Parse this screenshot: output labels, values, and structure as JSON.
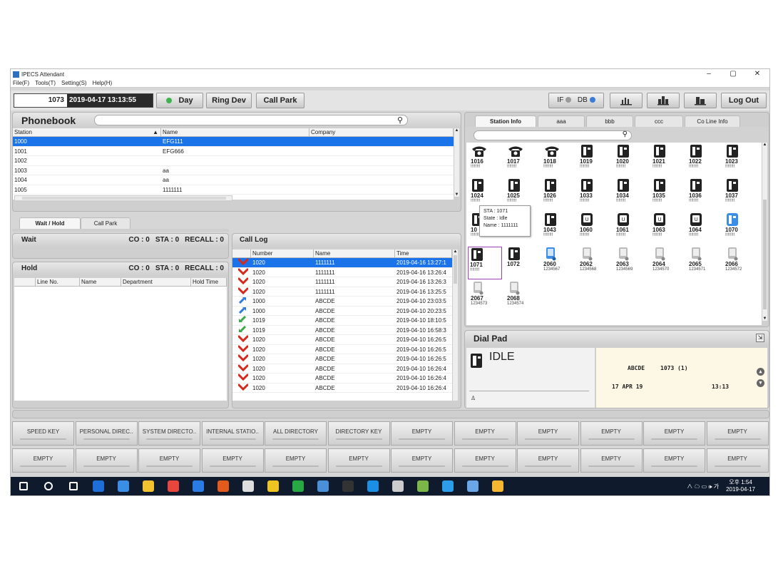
{
  "window": {
    "title": "IPECS Attendant",
    "menu": [
      "File(F)",
      "Tools(T)",
      "Setting(S)",
      "Help(H)"
    ],
    "controls": {
      "minimize": "–",
      "maximize": "▢",
      "close": "✕"
    }
  },
  "toolbar": {
    "extension": "1073",
    "datetime": "2019-04-17 13:13:55",
    "day_label": "Day",
    "ring_dev_label": "Ring Dev",
    "call_park_label": "Call Park",
    "if_label": "IF",
    "db_label": "DB",
    "logout_label": "Log Out",
    "colors": {
      "day_led": "#3cb44b",
      "if_led": "#9a9a9a",
      "db_led": "#3a7bd5"
    }
  },
  "phonebook": {
    "title": "Phonebook",
    "columns": [
      "Station",
      "Name",
      "Company"
    ],
    "rows": [
      {
        "station": "1000",
        "name": "EFG111",
        "company": "",
        "selected": true
      },
      {
        "station": "1001",
        "name": "EFG666",
        "company": ""
      },
      {
        "station": "1002",
        "name": "",
        "company": ""
      },
      {
        "station": "1003",
        "name": "aa",
        "company": ""
      },
      {
        "station": "1004",
        "name": "aa",
        "company": ""
      },
      {
        "station": "1005",
        "name": "1111111",
        "company": ""
      }
    ]
  },
  "wait_hold": {
    "tabs": [
      "Wait / Hold",
      "Call Park"
    ],
    "wait": {
      "title": "Wait",
      "co": "CO : 0",
      "sta": "STA : 0",
      "recall": "RECALL : 0"
    },
    "hold": {
      "title": "Hold",
      "co": "CO : 0",
      "sta": "STA : 0",
      "recall": "RECALL : 0",
      "columns": [
        "Line No.",
        "Name",
        "Department",
        "Hold Time"
      ]
    }
  },
  "call_log": {
    "title": "Call Log",
    "columns": [
      "Number",
      "Name",
      "Time"
    ],
    "rows": [
      {
        "type": "missed",
        "number": "1020",
        "name": "1111111",
        "time": "2019-04-16 13:27:1",
        "selected": true
      },
      {
        "type": "missed",
        "number": "1020",
        "name": "1111111",
        "time": "2019-04-16 13:26:4"
      },
      {
        "type": "missed",
        "number": "1020",
        "name": "1111111",
        "time": "2019-04-16 13:26:3"
      },
      {
        "type": "missed",
        "number": "1020",
        "name": "1111111",
        "time": "2019-04-16 13:25:5"
      },
      {
        "type": "outgoing",
        "number": "1000",
        "name": "ABCDE",
        "time": "2019-04-10 23:03:5"
      },
      {
        "type": "outgoing",
        "number": "1000",
        "name": "ABCDE",
        "time": "2019-04-10 20:23:5"
      },
      {
        "type": "incoming",
        "number": "1019",
        "name": "ABCDE",
        "time": "2019-04-10 18:10:5"
      },
      {
        "type": "incoming",
        "number": "1019",
        "name": "ABCDE",
        "time": "2019-04-10 16:58:3"
      },
      {
        "type": "missed",
        "number": "1020",
        "name": "ABCDE",
        "time": "2019-04-10 16:26:5"
      },
      {
        "type": "missed",
        "number": "1020",
        "name": "ABCDE",
        "time": "2019-04-10 16:26:5"
      },
      {
        "type": "missed",
        "number": "1020",
        "name": "ABCDE",
        "time": "2019-04-10 16:26:5"
      },
      {
        "type": "missed",
        "number": "1020",
        "name": "ABCDE",
        "time": "2019-04-10 16:26:4"
      },
      {
        "type": "missed",
        "number": "1020",
        "name": "ABCDE",
        "time": "2019-04-10 16:26:4"
      },
      {
        "type": "missed",
        "number": "1020",
        "name": "ABCDE",
        "time": "2019-04-10 16:26:4"
      }
    ]
  },
  "station_info": {
    "tabs": [
      "Station Info",
      "aaa",
      "bbb",
      "ccc",
      "Co Line Info"
    ],
    "stations": [
      {
        "num": "1016",
        "sub": "!!!!!!!!",
        "kind": "analog"
      },
      {
        "num": "1017",
        "sub": "!!!!!!!!",
        "kind": "analog"
      },
      {
        "num": "1018",
        "sub": "!!!!!!!!",
        "kind": "analog"
      },
      {
        "num": "1019",
        "sub": "!!!!!!!!",
        "kind": "digital"
      },
      {
        "num": "1020",
        "sub": "!!!!!!!!",
        "kind": "digital"
      },
      {
        "num": "1021",
        "sub": "!!!!!!!!",
        "kind": "digital"
      },
      {
        "num": "1022",
        "sub": "!!!!!!!!",
        "kind": "digital"
      },
      {
        "num": "1023",
        "sub": "!!!!!!!!",
        "kind": "digital"
      },
      {
        "num": "1024",
        "sub": "!!!!!!!!",
        "kind": "digital"
      },
      {
        "num": "1025",
        "sub": "!!!!!!!!",
        "kind": "digital"
      },
      {
        "num": "1026",
        "sub": "!!!!!!!!",
        "kind": "digital"
      },
      {
        "num": "1033",
        "sub": "!!!!!!!!",
        "kind": "digital"
      },
      {
        "num": "1034",
        "sub": "!!!!!!!!",
        "kind": "digital"
      },
      {
        "num": "1035",
        "sub": "!!!!!!!!",
        "kind": "digital"
      },
      {
        "num": "1036",
        "sub": "!!!!!!!!",
        "kind": "digital"
      },
      {
        "num": "1037",
        "sub": "!!!!!!!!",
        "kind": "digital"
      },
      {
        "num": "10",
        "sub": "!!!!!!!!",
        "kind": "digital"
      },
      {
        "num": "",
        "sub": "",
        "kind": "none"
      },
      {
        "num": "1043",
        "sub": "!!!!!!!!",
        "kind": "digital"
      },
      {
        "num": "1060",
        "sub": "!!!!!!!!",
        "kind": "ip"
      },
      {
        "num": "1061",
        "sub": "!!!!!!!!",
        "kind": "ip"
      },
      {
        "num": "1063",
        "sub": "!!!!!!!!",
        "kind": "ip"
      },
      {
        "num": "1064",
        "sub": "!!!!!!!!",
        "kind": "ip"
      },
      {
        "num": "1070",
        "sub": "!!!!!!!!",
        "kind": "ipblue"
      },
      {
        "num": "1071",
        "sub": "!!!!!!!!",
        "kind": "digital",
        "highlight": true
      },
      {
        "num": "1072",
        "sub": "",
        "kind": "digital"
      },
      {
        "num": "2060",
        "sub": "1234567",
        "kind": "mobileblue"
      },
      {
        "num": "2062",
        "sub": "1234568",
        "kind": "mobile"
      },
      {
        "num": "2063",
        "sub": "1234569",
        "kind": "mobile"
      },
      {
        "num": "2064",
        "sub": "1234570",
        "kind": "mobile"
      },
      {
        "num": "2065",
        "sub": "1234571",
        "kind": "mobile"
      },
      {
        "num": "2066",
        "sub": "1234572",
        "kind": "mobile"
      },
      {
        "num": "2067",
        "sub": "1234573",
        "kind": "mobile"
      },
      {
        "num": "2068",
        "sub": "1234574",
        "kind": "mobile"
      }
    ],
    "tooltip": {
      "sta": "STA : 1071",
      "state": "State : Idle",
      "name": "Name : 1111111"
    }
  },
  "dial_pad": {
    "title": "Dial Pad",
    "state": "IDLE",
    "lcd_line1_name": "ABCDE",
    "lcd_line1_ext": "1073 (1)",
    "lcd_line2_date": "17 APR 19",
    "lcd_line2_time": "13:13"
  },
  "function_keys": {
    "row1": [
      "SPEED KEY",
      "PERSONAL DIREC..",
      "SYSTEM DIRECTO..",
      "INTERNAL STATIO..",
      "ALL DIRECTORY",
      "DIRECTORY KEY",
      "EMPTY",
      "EMPTY",
      "EMPTY",
      "EMPTY",
      "EMPTY",
      "EMPTY"
    ],
    "row2": [
      "EMPTY",
      "EMPTY",
      "EMPTY",
      "EMPTY",
      "EMPTY",
      "EMPTY",
      "EMPTY",
      "EMPTY",
      "EMPTY",
      "EMPTY",
      "EMPTY",
      "EMPTY"
    ]
  },
  "taskbar": {
    "time": "오후 1:54",
    "date": "2019-04-17",
    "tray": "∧ ☁ ▭ 🕪 가",
    "app_colors": [
      "#ffffff",
      "#ffffff",
      "#ffffff",
      "#1e6fd9",
      "#3a8ee6",
      "#f2c230",
      "#e8453c",
      "#2a7be4",
      "#e25a1c",
      "#dddddd",
      "#f0c420",
      "#27a844",
      "#4a90d9",
      "#333333",
      "#1a8fe3",
      "#cccccc",
      "#7ab648",
      "#2b9de9",
      "#6aa7e8",
      "#f7b731"
    ]
  }
}
